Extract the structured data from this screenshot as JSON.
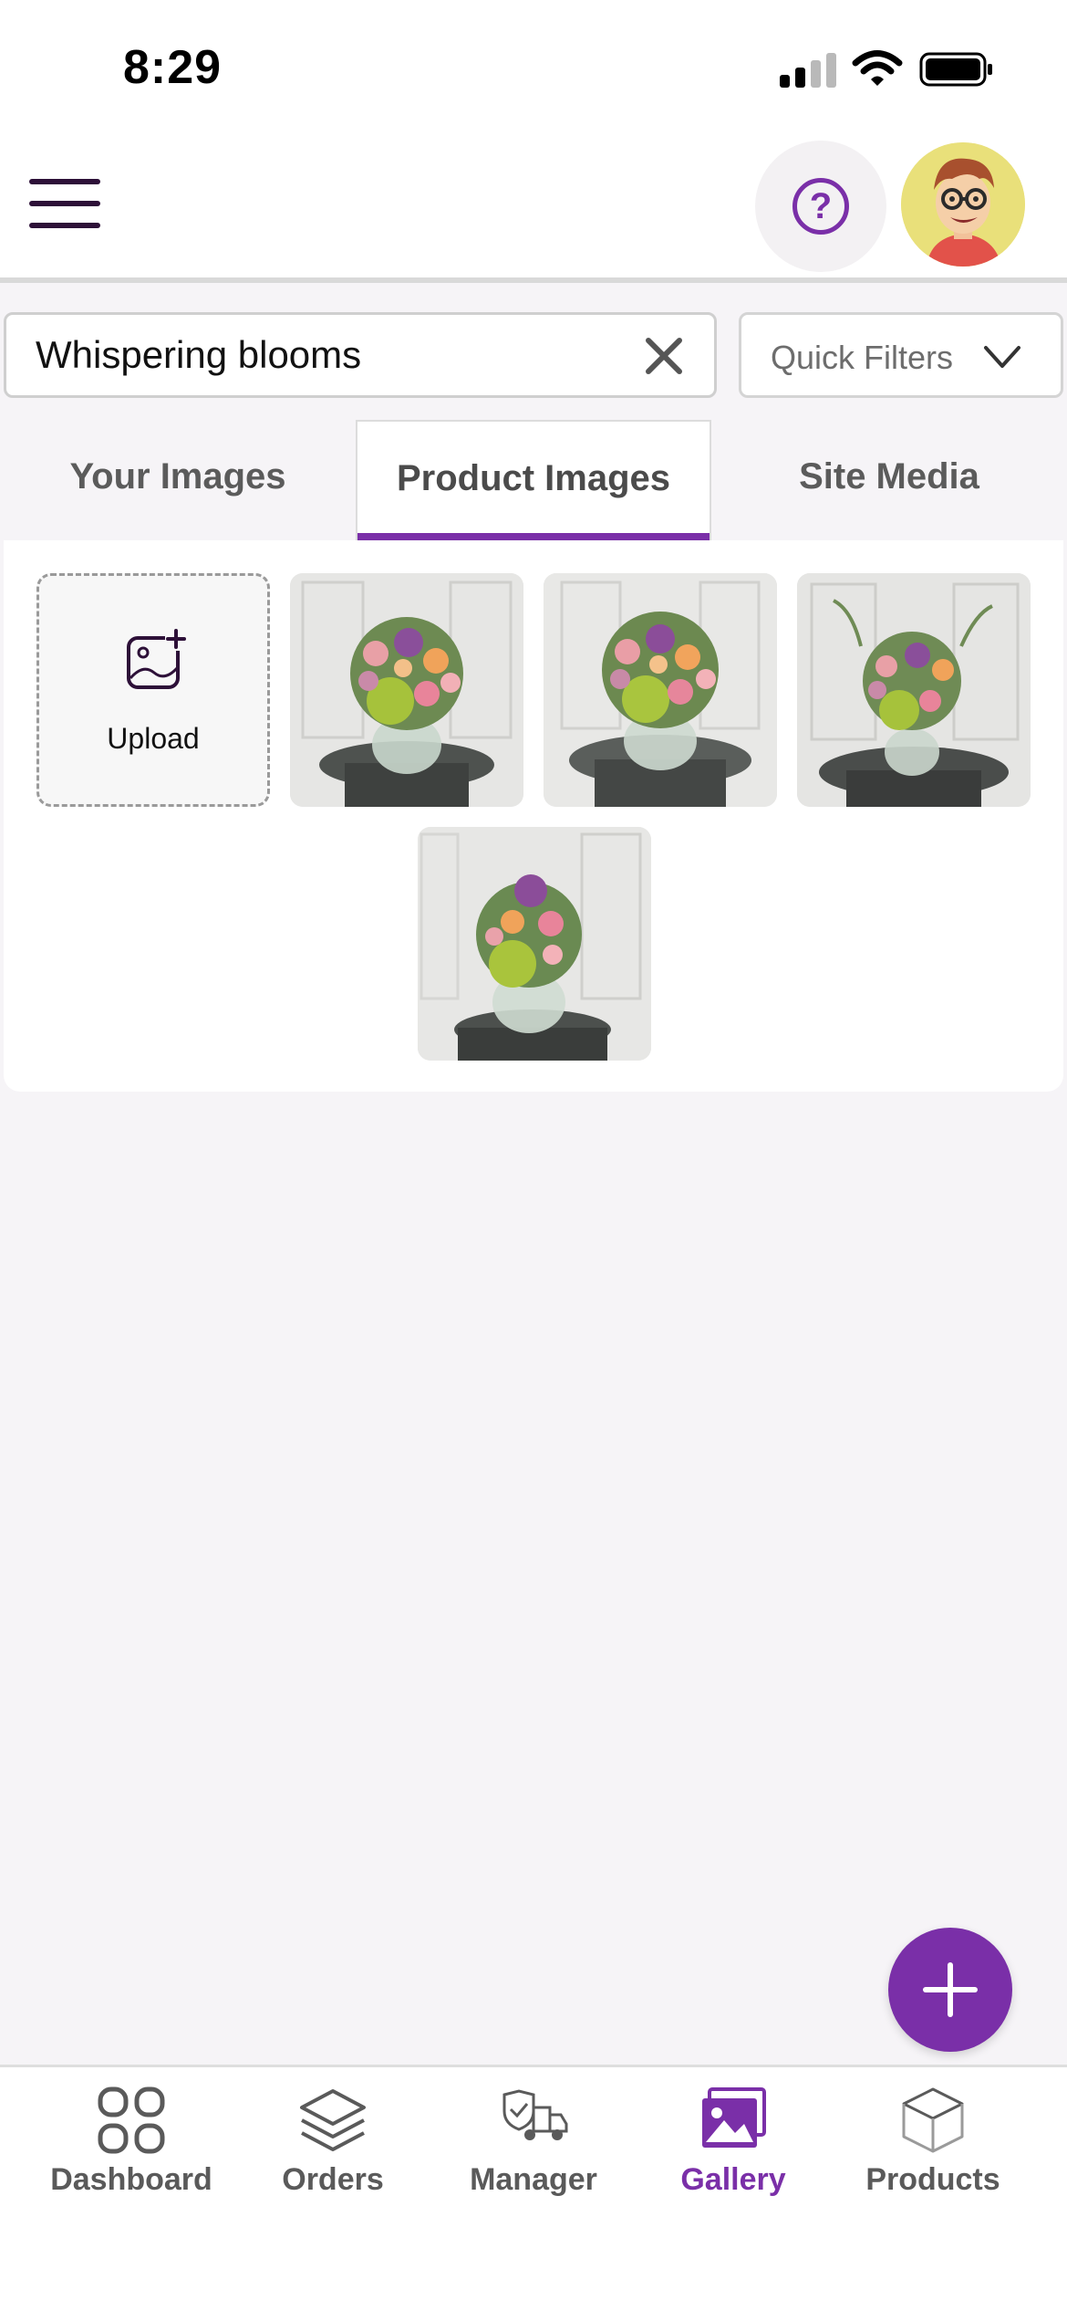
{
  "status_bar": {
    "time": "8:29"
  },
  "header": {
    "menu_icon": "hamburger-menu-icon",
    "help_icon": "question-circle-icon",
    "help_glyph": "?",
    "avatar_icon": "cartoon-avatar-icon"
  },
  "search": {
    "value": "Whispering blooms",
    "clear_icon": "close-icon"
  },
  "quick_filters": {
    "label": "Quick Filters",
    "chevron_icon": "chevron-down-icon"
  },
  "tabs": [
    {
      "label": "Your Images",
      "active": false
    },
    {
      "label": "Product Images",
      "active": true
    },
    {
      "label": "Site Media",
      "active": false
    }
  ],
  "gallery": {
    "upload_label": "Upload",
    "upload_icon": "image-plus-icon"
  },
  "fab": {
    "icon": "plus-icon"
  },
  "bottom_nav": [
    {
      "label": "Dashboard",
      "icon": "grid-icon",
      "active": false
    },
    {
      "label": "Orders",
      "icon": "layers-icon",
      "active": false
    },
    {
      "label": "Manager",
      "icon": "delivery-truck-icon",
      "active": false
    },
    {
      "label": "Gallery",
      "icon": "gallery-image-icon",
      "active": true
    },
    {
      "label": "Products",
      "icon": "box-icon",
      "active": false
    }
  ],
  "colors": {
    "accent": "#7a2fa8",
    "menu": "#2d1038",
    "background": "#f6f4f7"
  }
}
